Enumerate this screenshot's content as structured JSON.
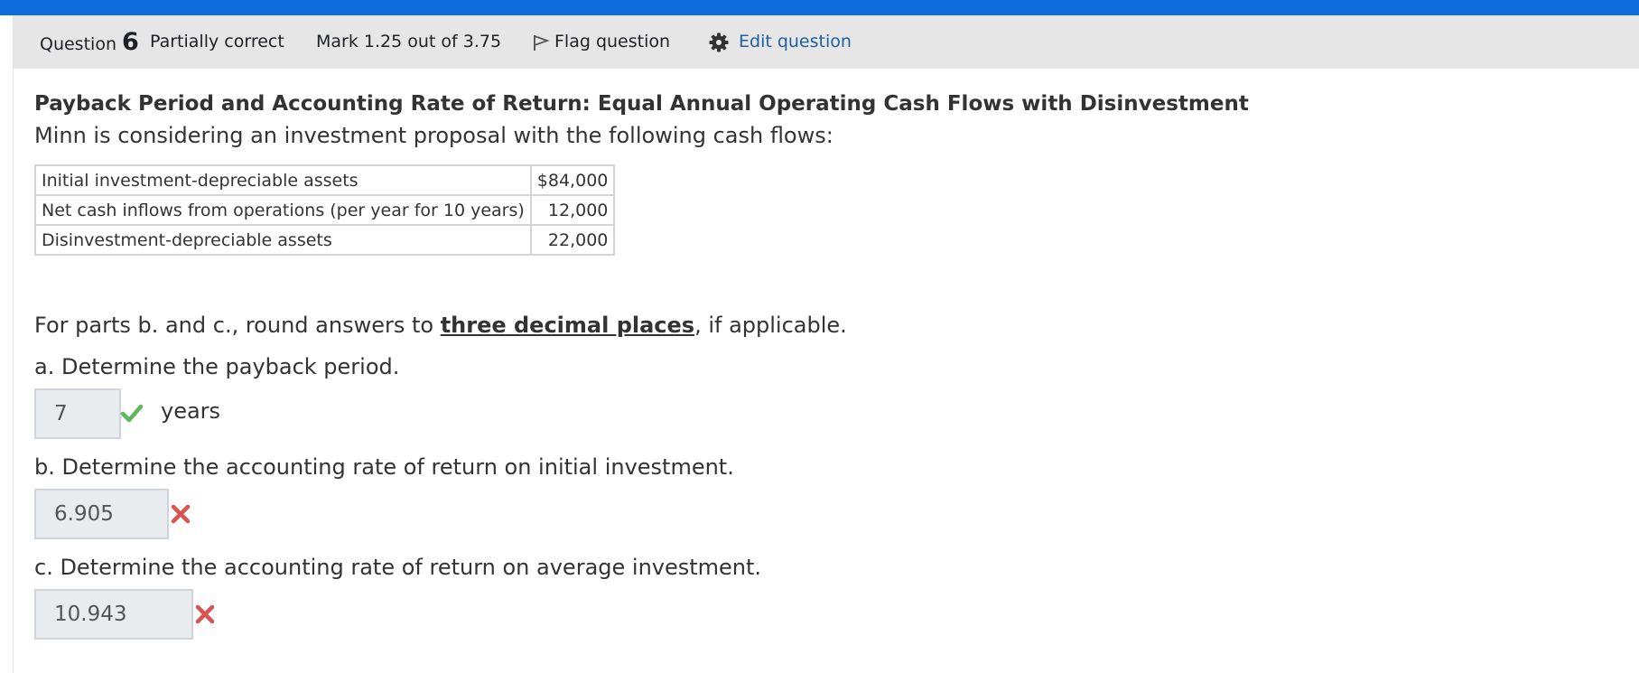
{
  "header": {
    "question_word": "Question",
    "question_number": "6",
    "status": "Partially correct",
    "mark": "Mark 1.25 out of 3.75",
    "flag_label": "Flag question",
    "edit_label": "Edit question"
  },
  "question": {
    "title": "Payback Period and Accounting Rate of Return: Equal Annual Operating Cash Flows with Disinvestment",
    "intro": "Minn is considering an investment proposal with the following cash flows:",
    "table": [
      {
        "label": "Initial investment-depreciable assets",
        "amount": "$84,000"
      },
      {
        "label": "Net cash inflows from operations (per year for 10 years)",
        "amount": "12,000"
      },
      {
        "label": "Disinvestment-depreciable assets",
        "amount": "22,000"
      }
    ],
    "note_prefix": "For parts b. and c., round answers to ",
    "note_emphasis": "three decimal places",
    "note_suffix": ", if applicable."
  },
  "parts": [
    {
      "label": "a. Determine the payback period.",
      "answer": "7",
      "unit": "years",
      "status": "correct"
    },
    {
      "label": "b. Determine the accounting rate of return on initial investment.",
      "answer": "6.905",
      "unit": "",
      "status": "incorrect"
    },
    {
      "label": "c. Determine the accounting rate of return on average investment.",
      "answer": "10.943",
      "unit": "",
      "status": "incorrect"
    }
  ],
  "colors": {
    "topbar": "#0f6cde",
    "correct": "#5cb85c",
    "incorrect": "#d9534f",
    "link": "#1f5f9e"
  },
  "icons": [
    "flag-icon",
    "gear-icon",
    "check-icon",
    "cross-icon"
  ]
}
